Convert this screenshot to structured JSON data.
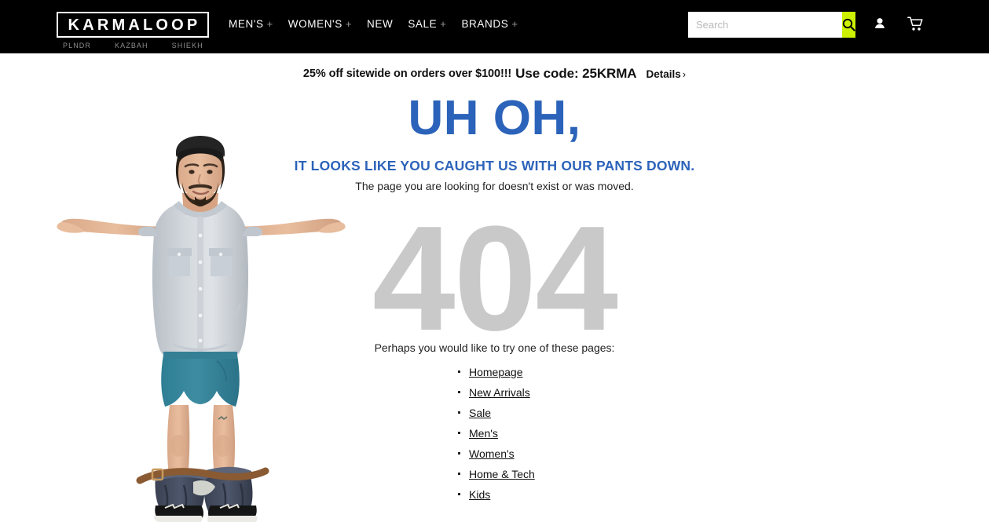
{
  "header": {
    "logo": "KARMALOOP",
    "subnav": [
      {
        "label": "PLNDR"
      },
      {
        "label": "KAZBAH"
      },
      {
        "label": "SHIEKH"
      }
    ],
    "nav": [
      {
        "label": "MEN'S",
        "plus": "+"
      },
      {
        "label": "WOMEN'S",
        "plus": "+"
      },
      {
        "label": "NEW",
        "plus": ""
      },
      {
        "label": "SALE",
        "plus": "+"
      },
      {
        "label": "BRANDS",
        "plus": "+"
      }
    ],
    "search": {
      "placeholder": "Search",
      "value": "",
      "icon": "search-icon"
    },
    "icons": [
      {
        "name": "account-icon"
      },
      {
        "name": "cart-icon"
      }
    ],
    "colors": {
      "background": "#000000",
      "search_button": "#ccf000",
      "nav_text": "#ffffff",
      "subnav_text": "#8d8d8d"
    }
  },
  "promo": {
    "text_normal": "25% off sitewide on orders over $100!!!",
    "text_emphasis": "Use code: 25KRMA",
    "details_label": "Details",
    "details_chevron": "›"
  },
  "error_page": {
    "headline": "UH OH,",
    "subheadline": "IT LOOKS LIKE YOU CAUGHT US WITH OUR PANTS DOWN.",
    "description": "The page you are looking for doesn't exist or was moved.",
    "code": "404",
    "suggestion_intro": "Perhaps you would like to try one of these pages:",
    "links": [
      {
        "label": "Homepage"
      },
      {
        "label": "New Arrivals"
      },
      {
        "label": "Sale"
      },
      {
        "label": "Men's"
      },
      {
        "label": "Women's"
      },
      {
        "label": "Home & Tech"
      },
      {
        "label": "Kids"
      }
    ],
    "colors": {
      "headline": "#2c63ba",
      "code": "#c9c9c9",
      "body_text": "#222222"
    },
    "illustration": "shrugging-man-with-pants-down-photo"
  }
}
